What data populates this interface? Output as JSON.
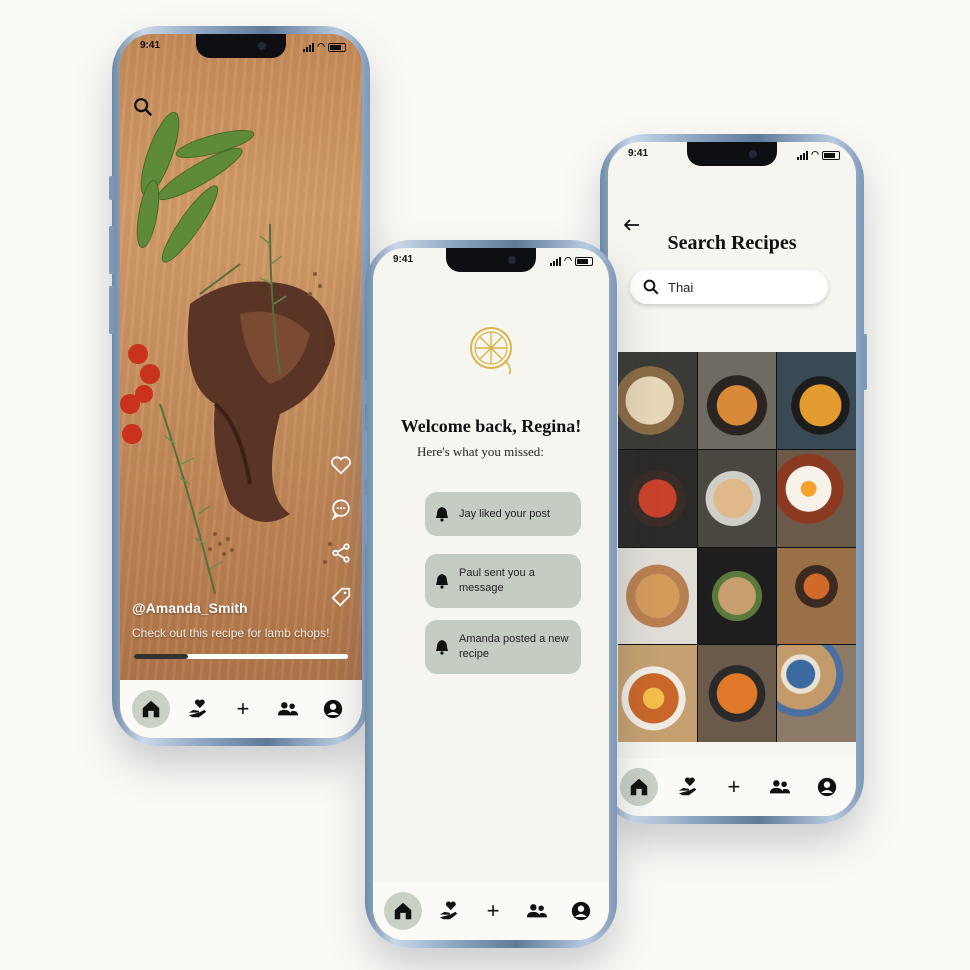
{
  "phone_feed": {
    "time": "9:41",
    "username": "@Amanda_Smith",
    "caption": "Check out this recipe for lamb chops!",
    "progress_fraction": 0.25,
    "icons": [
      "search-icon",
      "heart-icon",
      "comment-icon",
      "share-icon",
      "tag-icon"
    ]
  },
  "phone_home": {
    "time": "9:41",
    "welcome": "Welcome back, Regina!",
    "subtitle": "Here's what you missed:",
    "notifications": [
      {
        "text": "Jay liked your post"
      },
      {
        "text": "Paul sent you a message"
      },
      {
        "text": "Amanda posted a new recipe"
      }
    ]
  },
  "phone_search": {
    "time": "9:41",
    "title": "Search Recipes",
    "query": "Thai"
  },
  "tabbar": {
    "items": [
      "home-icon",
      "donate-heart-icon",
      "plus-icon",
      "friends-icon",
      "profile-icon"
    ],
    "plus_label": "+"
  },
  "colors": {
    "accent": "#c9d1c5",
    "notification_bg": "#c5ccc1",
    "logo_gold": "#d8b44a",
    "background": "#fbfaf6"
  }
}
